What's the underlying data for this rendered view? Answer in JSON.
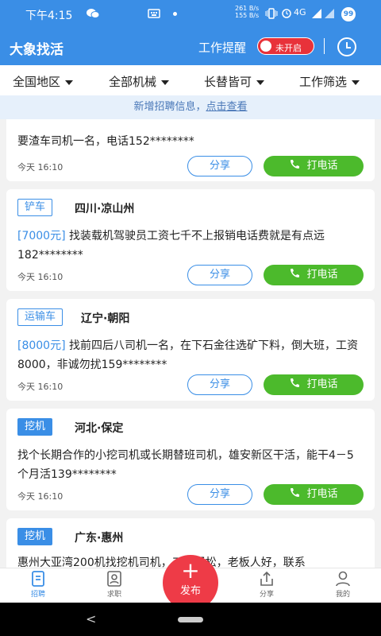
{
  "status_bar": {
    "time": "下午4:15",
    "net_up": "261 B/s",
    "net_down": "155 B/s",
    "network": "4G",
    "battery": "99"
  },
  "header": {
    "title": "大象找活",
    "remind_label": "工作提醒",
    "toggle_label": "未开启",
    "clock_icon": "clock-icon"
  },
  "filters": [
    {
      "label": "全国地区"
    },
    {
      "label": "全部机械"
    },
    {
      "label": "长替皆可"
    },
    {
      "label": "工作筛选"
    }
  ],
  "notice": {
    "text": "新增招聘信息，",
    "link": "点击查看"
  },
  "actions": {
    "share": "分享",
    "call": "打电话"
  },
  "posts": [
    {
      "tag": "",
      "location": "",
      "price": "",
      "description": "要渣车司机一名，电话152********",
      "time": "今天 16:10"
    },
    {
      "tag": "铲车",
      "location": "四川·凉山州",
      "price": "[7000元]",
      "description": "找装载机驾驶员工资七千不上报销电话费就是有点远182********",
      "time": "今天 16:10"
    },
    {
      "tag": "运输车",
      "location": "辽宁·朝阳",
      "price": "[8000元]",
      "description": "找前四后八司机一名，在下石金往选矿下料，倒大班，工资8000，非诚勿扰159********",
      "time": "今天 16:10"
    },
    {
      "tag": "挖机",
      "location": "河北·保定",
      "price": "",
      "description": "找个长期合作的小挖司机或长期替班司机，雄安新区干活，能干4－5个月活139********",
      "time": "今天 16:10"
    },
    {
      "tag": "挖机",
      "location": "广东·惠州",
      "price": "",
      "description": "惠州大亚湾200机找挖机司机，工作轻松，老板人好，联系",
      "time": ""
    }
  ],
  "tabs": [
    {
      "label": "招聘",
      "icon": "recruit-icon"
    },
    {
      "label": "求职",
      "icon": "job-seek-icon"
    },
    {
      "label": "分享",
      "icon": "share-icon"
    },
    {
      "label": "我的",
      "icon": "profile-icon"
    }
  ],
  "publish": {
    "label": "发布"
  },
  "colors": {
    "brand": "#3a8ee6",
    "call_green": "#4cba2c",
    "publish_red": "#ee3b47",
    "toggle_red": "#e8323a"
  }
}
